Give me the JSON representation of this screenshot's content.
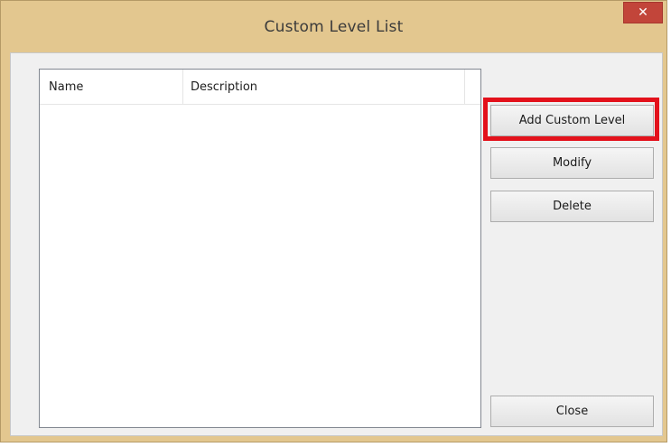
{
  "window": {
    "title": "Custom Level List",
    "close_glyph": "✕"
  },
  "listview": {
    "columns": [
      "Name",
      "Description"
    ],
    "rows": []
  },
  "buttons": {
    "add_label": "Add Custom Level",
    "modify_label": "Modify",
    "delete_label": "Delete",
    "close_label": "Close"
  },
  "colors": {
    "titlebar": "#e3c78f",
    "close_button": "#c2453a",
    "highlight": "#e3111b",
    "client": "#f0f0f0"
  },
  "icons": {
    "close": "close-icon"
  }
}
